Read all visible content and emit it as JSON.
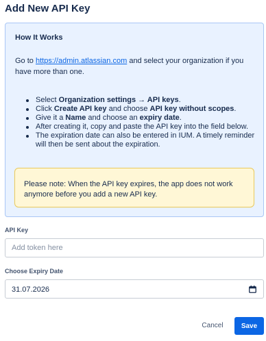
{
  "dialog": {
    "title": "Add New API Key"
  },
  "info": {
    "title": "How It Works",
    "intro_prefix": "Go to ",
    "link_text": "https://admin.atlassian.com",
    "intro_suffix": " and select your organization if you have more than one.",
    "steps": [
      {
        "a": "Select ",
        "b": "Organization settings → API keys",
        "c": ".",
        "d": "",
        "e": ""
      },
      {
        "a": "Click ",
        "b": "Create API key",
        "c": " and choose ",
        "d": "API key without scopes",
        "e": "."
      },
      {
        "a": "Give it a ",
        "b": "Name",
        "c": " and choose an ",
        "d": "expiry date",
        "e": "."
      },
      {
        "a": "After creating it, copy and paste the API key into the field below.",
        "b": "",
        "c": "",
        "d": "",
        "e": ""
      },
      {
        "a": "The expiration date can also be entered in IUM. A timely reminder will then be sent about the expiration.",
        "b": "",
        "c": "",
        "d": "",
        "e": ""
      }
    ],
    "note": "Please note: When the API key expires, the app does not work anymore before you add a new API key."
  },
  "form": {
    "api_key_label": "API Key",
    "api_key_placeholder": "Add token here",
    "expiry_label": "Choose Expiry Date",
    "expiry_value": "31.07.2026"
  },
  "actions": {
    "cancel": "Cancel",
    "save": "Save"
  },
  "icons": {
    "expiry": "calendar-icon"
  },
  "colors": {
    "primary": "#0c66e4",
    "info_bg": "#e9f2ff",
    "note_bg": "#fff7d6"
  }
}
